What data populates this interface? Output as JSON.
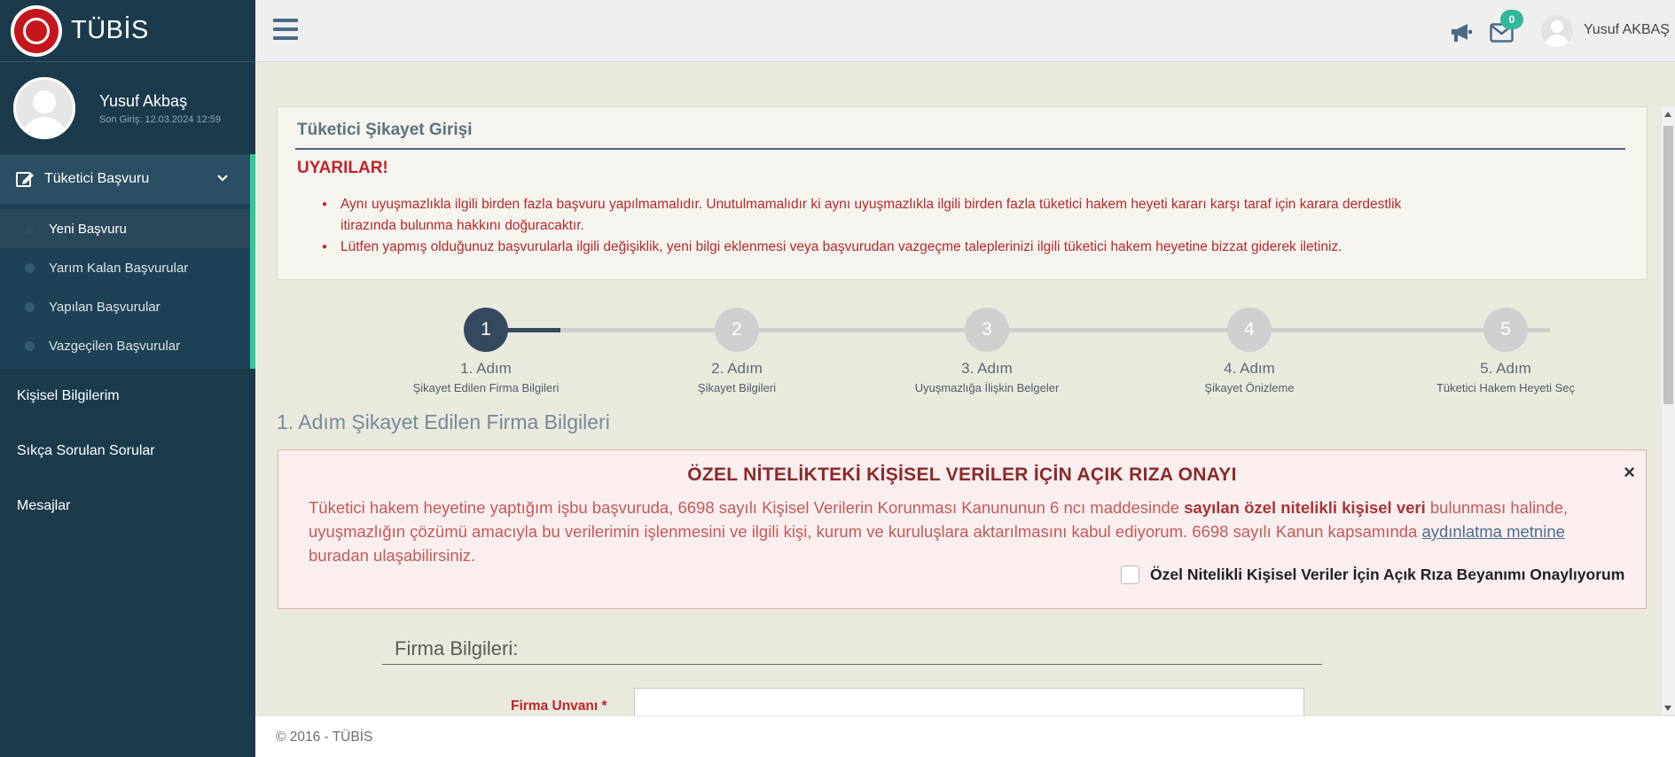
{
  "sidebar": {
    "brand": "TÜBİS",
    "user_name": "Yusuf Akbaş",
    "last_login": "Son Giriş: 12.03.2024 12:59",
    "open_menu": {
      "label": "Tüketici Başvuru",
      "items": [
        {
          "label": "Yeni Başvuru",
          "active": true
        },
        {
          "label": "Yarım Kalan Başvurular",
          "active": false
        },
        {
          "label": "Yapılan Başvurular",
          "active": false
        },
        {
          "label": "Vazgeçilen Başvurular",
          "active": false
        }
      ]
    },
    "menu": [
      {
        "label": "Kişisel Bilgilerim"
      },
      {
        "label": "Sıkça Sorulan Sorular"
      },
      {
        "label": "Mesajlar"
      }
    ]
  },
  "topbar": {
    "badge_count": "0",
    "user_name": "Yusuf AKBAŞ"
  },
  "panel": {
    "title": "Tüketici Şikayet Girişi",
    "warning_title": "UYARILAR!",
    "warnings": [
      "Aynı uyuşmazlıkla ilgili birden fazla başvuru yapılmamalıdır. Unutulmamalıdır ki aynı uyuşmazlıkla ilgili birden fazla tüketici hakem heyeti kararı karşı taraf için karara derdestlik itirazında bulunma hakkını doğuracaktır.",
      "Lütfen yapmış olduğunuz başvurularla ilgili değişiklik, yeni bilgi eklenmesi veya başvurudan vazgeçme taleplerinizi ilgili tüketici hakem heyetine bizzat giderek iletiniz."
    ]
  },
  "stepper": {
    "progress": 0.07,
    "steps": [
      {
        "number": "1",
        "label": "1. Adım",
        "sub": "Şikayet Edilen Firma Bilgileri",
        "active": true
      },
      {
        "number": "2",
        "label": "2. Adım",
        "sub": "Şikayet Bilgileri",
        "active": false
      },
      {
        "number": "3",
        "label": "3. Adım",
        "sub": "Uyuşmazlığa İlişkin Belgeler",
        "active": false
      },
      {
        "number": "4",
        "label": "4. Adım",
        "sub": "Şikayet Önizleme",
        "active": false
      },
      {
        "number": "5",
        "label": "5. Adım",
        "sub": "Tüketici Hakem Heyeti Seç",
        "active": false
      }
    ]
  },
  "section_title": "1. Adım Şikayet Edilen Firma Bilgileri",
  "consent": {
    "title": "ÖZEL NİTELİKTEKİ KİŞİSEL VERİLER İÇİN AÇIK RIZA ONAYI",
    "close": "×",
    "text_1": "Tüketici hakem heyetine yaptığım işbu başvuruda, 6698 sayılı Kişisel Verilerin Korunması Kanununun 6 ncı maddesinde ",
    "text_bold": "sayılan özel nitelikli kişisel veri",
    "text_2": " bulunması halinde, uyuşmazlığın çözümü amacıyla bu verilerimin işlenmesini ve ilgili kişi, kurum ve kuruluşlara aktarılmasını kabul ediyorum. 6698 sayılı Kanun kapsamında ",
    "link": "aydınlatma metnine",
    "text_3": " buradan ulaşabilirsiniz.",
    "checkbox_label": "Özel Nitelikli Kişisel Veriler İçin Açık Rıza Beyanımı Onaylıyorum"
  },
  "firma": {
    "title": "Firma Bilgileri:",
    "unvan_label": "Firma Unvanı *",
    "unvan_value": ""
  },
  "footer": "© 2016 - TÜBİS",
  "colors": {
    "sidebar": "#1b3b4d",
    "accent_green": "#2fcb97",
    "step_active": "#34495e",
    "step_inactive": "#cfcfcf",
    "warning_red": "#c0242b"
  }
}
